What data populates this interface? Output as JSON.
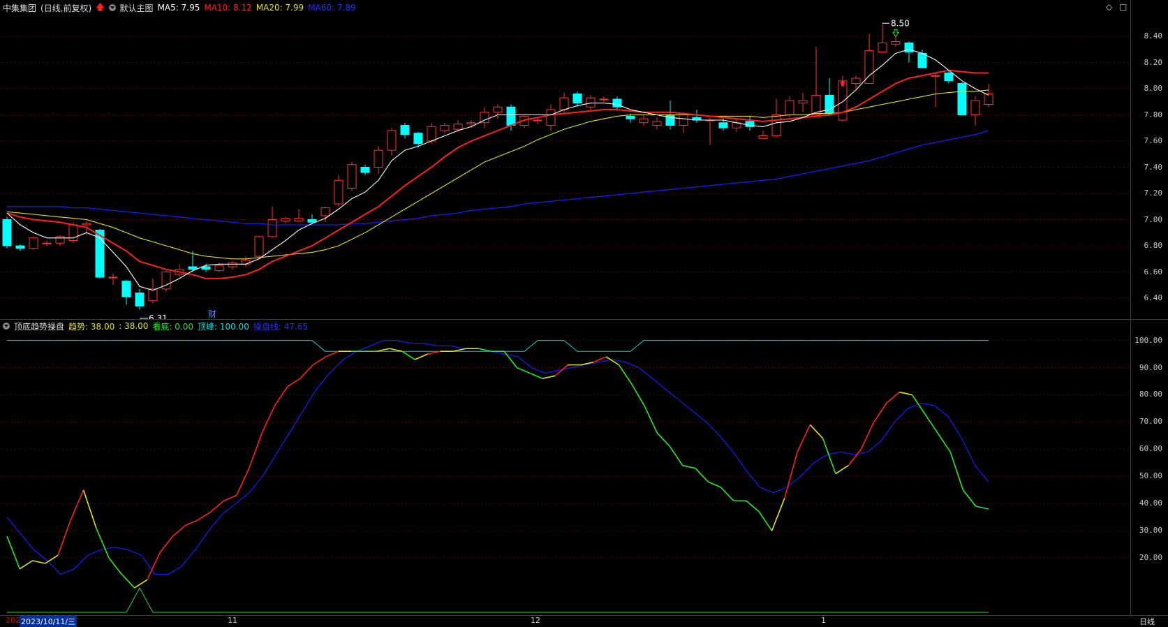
{
  "header": {
    "stock_name": "中集集团",
    "period": "(日线,前复权)",
    "chart_template": "默认主图",
    "ma5": "MA5: 7.95",
    "ma10": "MA10: 8.12",
    "ma20": "MA20: 7.99",
    "ma60": "MA60: 7.89"
  },
  "indicator_header": {
    "name": "顶底趋势操盘",
    "trend": "趋势: 38.00",
    "trend2": ": 38.00",
    "bottom": "看底: 0.00",
    "top": "顶峰: 100.00",
    "baseline": "操盘线: 47.65"
  },
  "annotations": {
    "high_label": "8.50",
    "low_label": "6.31",
    "finance_mark": "财"
  },
  "bottom_bar": {
    "date_cursor": "2023/10/11/三",
    "month_start": "202",
    "m11": "11",
    "m12": "12",
    "m1": "1",
    "period_button": "日线"
  },
  "right_buttons": {
    "diamond": "◇",
    "square": "□"
  },
  "price_axis": [
    "8.40",
    "8.20",
    "8.00",
    "7.80",
    "7.60",
    "7.40",
    "7.20",
    "7.00",
    "6.80",
    "6.60",
    "6.40"
  ],
  "ind_axis": [
    "100.00",
    "90.00",
    "80.00",
    "70.00",
    "60.00",
    "50.00",
    "40.00",
    "30.00",
    "20.00"
  ],
  "colors": {
    "up": "#ff3232",
    "down": "#00ffff",
    "ma5": "#ffffff",
    "ma10": "#ff2020",
    "ma20": "#e6e600",
    "ma60": "#1a1aff",
    "frame": "#c00000",
    "grid": "#5a0000"
  },
  "chart_data": {
    "type": "candlestick",
    "price_ylim": [
      6.24,
      8.56
    ],
    "candles": [
      [
        7.0,
        6.8,
        7.02,
        6.78
      ],
      [
        6.8,
        6.78,
        6.81,
        6.76
      ],
      [
        6.78,
        6.86,
        6.87,
        6.77
      ],
      [
        6.82,
        6.82,
        6.84,
        6.8
      ],
      [
        6.82,
        6.87,
        6.88,
        6.8
      ],
      [
        6.84,
        6.96,
        6.98,
        6.82
      ],
      [
        6.96,
        6.97,
        6.99,
        6.88
      ],
      [
        6.92,
        6.56,
        6.93,
        6.55
      ],
      [
        6.56,
        6.56,
        6.59,
        6.5
      ],
      [
        6.53,
        6.41,
        6.54,
        6.35
      ],
      [
        6.44,
        6.34,
        6.47,
        6.31
      ],
      [
        6.38,
        6.47,
        6.55,
        6.36
      ],
      [
        6.47,
        6.6,
        6.61,
        6.45
      ],
      [
        6.58,
        6.62,
        6.66,
        6.56
      ],
      [
        6.64,
        6.62,
        6.76,
        6.6
      ],
      [
        6.64,
        6.62,
        6.66,
        6.6
      ],
      [
        6.61,
        6.65,
        6.67,
        6.6
      ],
      [
        6.64,
        6.67,
        6.68,
        6.62
      ],
      [
        6.66,
        6.69,
        6.72,
        6.64
      ],
      [
        6.72,
        6.87,
        6.88,
        6.7
      ],
      [
        6.87,
        7.0,
        7.1,
        6.86
      ],
      [
        6.99,
        7.01,
        7.02,
        6.97
      ],
      [
        6.99,
        7.01,
        7.08,
        6.98
      ],
      [
        7.0,
        6.98,
        7.04,
        6.96
      ],
      [
        7.03,
        7.09,
        7.1,
        6.98
      ],
      [
        7.12,
        7.3,
        7.34,
        7.1
      ],
      [
        7.24,
        7.42,
        7.44,
        7.22
      ],
      [
        7.4,
        7.36,
        7.42,
        7.34
      ],
      [
        7.4,
        7.53,
        7.56,
        7.35
      ],
      [
        7.53,
        7.68,
        7.7,
        7.49
      ],
      [
        7.72,
        7.65,
        7.74,
        7.62
      ],
      [
        7.66,
        7.58,
        7.67,
        7.55
      ],
      [
        7.6,
        7.71,
        7.74,
        7.58
      ],
      [
        7.68,
        7.72,
        7.74,
        7.66
      ],
      [
        7.69,
        7.73,
        7.76,
        7.67
      ],
      [
        7.73,
        7.74,
        7.76,
        7.7
      ],
      [
        7.74,
        7.82,
        7.86,
        7.7
      ],
      [
        7.82,
        7.86,
        7.88,
        7.77
      ],
      [
        7.86,
        7.72,
        7.88,
        7.68
      ],
      [
        7.72,
        7.79,
        7.8,
        7.7
      ],
      [
        7.76,
        7.76,
        7.78,
        7.73
      ],
      [
        7.72,
        7.84,
        7.88,
        7.68
      ],
      [
        7.84,
        7.93,
        7.97,
        7.8
      ],
      [
        7.96,
        7.89,
        7.98,
        7.86
      ],
      [
        7.86,
        7.93,
        7.95,
        7.84
      ],
      [
        7.92,
        7.92,
        7.94,
        7.9
      ],
      [
        7.92,
        7.86,
        7.94,
        7.83
      ],
      [
        7.79,
        7.77,
        7.81,
        7.74
      ],
      [
        7.74,
        7.77,
        7.8,
        7.72
      ],
      [
        7.72,
        7.75,
        7.78,
        7.69
      ],
      [
        7.8,
        7.72,
        7.91,
        7.69
      ],
      [
        7.72,
        7.8,
        7.82,
        7.66
      ],
      [
        7.78,
        7.76,
        7.84,
        7.74
      ],
      [
        7.76,
        7.76,
        7.78,
        7.57
      ],
      [
        7.74,
        7.7,
        7.77,
        7.68
      ],
      [
        7.7,
        7.74,
        7.76,
        7.67
      ],
      [
        7.75,
        7.71,
        7.79,
        7.68
      ],
      [
        7.62,
        7.64,
        7.68,
        7.62
      ],
      [
        7.64,
        7.8,
        7.92,
        7.63
      ],
      [
        7.8,
        7.91,
        7.94,
        7.78
      ],
      [
        7.89,
        7.91,
        7.97,
        7.82
      ],
      [
        7.8,
        7.95,
        8.32,
        7.8
      ],
      [
        7.95,
        7.81,
        8.08,
        7.79
      ],
      [
        7.76,
        8.06,
        8.1,
        7.75
      ],
      [
        8.04,
        8.08,
        8.1,
        8.0
      ],
      [
        8.04,
        8.29,
        8.42,
        8.04
      ],
      [
        8.28,
        8.35,
        8.5,
        8.28
      ],
      [
        8.34,
        8.36,
        8.4,
        8.32
      ],
      [
        8.35,
        8.28,
        8.36,
        8.2
      ],
      [
        8.27,
        8.16,
        8.3,
        8.16
      ],
      [
        8.1,
        8.1,
        8.12,
        7.86
      ],
      [
        8.12,
        8.06,
        8.14,
        8.04
      ],
      [
        8.04,
        7.8,
        8.05,
        7.8
      ],
      [
        7.8,
        7.91,
        7.94,
        7.72
      ],
      [
        7.88,
        7.96,
        8.04,
        7.86
      ]
    ],
    "ma5": [
      7.05,
      6.96,
      6.9,
      6.86,
      6.86,
      6.86,
      6.9,
      6.86,
      6.75,
      6.64,
      6.49,
      6.46,
      6.5,
      6.55,
      6.61,
      6.65,
      6.66,
      6.66,
      6.66,
      6.7,
      6.77,
      6.84,
      6.92,
      6.97,
      7.01,
      7.08,
      7.16,
      7.21,
      7.3,
      7.45,
      7.53,
      7.56,
      7.6,
      7.64,
      7.68,
      7.71,
      7.76,
      7.8,
      7.8,
      7.8,
      7.8,
      7.8,
      7.84,
      7.87,
      7.89,
      7.89,
      7.88,
      7.84,
      7.82,
      7.8,
      7.78,
      7.77,
      7.76,
      7.76,
      7.76,
      7.74,
      7.72,
      7.71,
      7.74,
      7.75,
      7.78,
      7.82,
      7.84,
      7.9,
      7.99,
      8.1,
      8.18,
      8.27,
      8.3,
      8.27,
      8.22,
      8.14,
      8.06,
      8.0,
      7.95
    ],
    "ma10": [
      7.05,
      7.02,
      7.0,
      6.99,
      6.98,
      6.96,
      6.94,
      6.88,
      6.82,
      6.76,
      6.68,
      6.65,
      6.62,
      6.6,
      6.58,
      6.55,
      6.55,
      6.56,
      6.58,
      6.62,
      6.68,
      6.72,
      6.76,
      6.8,
      6.86,
      6.92,
      6.98,
      7.04,
      7.1,
      7.18,
      7.26,
      7.33,
      7.4,
      7.48,
      7.55,
      7.6,
      7.64,
      7.68,
      7.72,
      7.76,
      7.78,
      7.8,
      7.81,
      7.82,
      7.83,
      7.84,
      7.84,
      7.83,
      7.82,
      7.82,
      7.82,
      7.81,
      7.8,
      7.79,
      7.78,
      7.77,
      7.76,
      7.75,
      7.76,
      7.77,
      7.78,
      7.79,
      7.8,
      7.82,
      7.86,
      7.92,
      7.98,
      8.04,
      8.08,
      8.1,
      8.12,
      8.14,
      8.13,
      8.12,
      8.12
    ],
    "ma20": [
      7.06,
      7.05,
      7.04,
      7.03,
      7.02,
      7.01,
      7.0,
      6.97,
      6.94,
      6.9,
      6.86,
      6.83,
      6.8,
      6.77,
      6.74,
      6.72,
      6.71,
      6.7,
      6.7,
      6.71,
      6.72,
      6.73,
      6.74,
      6.75,
      6.77,
      6.8,
      6.85,
      6.9,
      6.96,
      7.02,
      7.08,
      7.14,
      7.2,
      7.26,
      7.32,
      7.38,
      7.44,
      7.48,
      7.52,
      7.56,
      7.61,
      7.65,
      7.69,
      7.72,
      7.75,
      7.77,
      7.79,
      7.8,
      7.8,
      7.8,
      7.8,
      7.8,
      7.8,
      7.79,
      7.79,
      7.79,
      7.79,
      7.78,
      7.79,
      7.8,
      7.8,
      7.81,
      7.81,
      7.82,
      7.84,
      7.86,
      7.88,
      7.9,
      7.92,
      7.94,
      7.96,
      7.97,
      7.98,
      7.98,
      7.99
    ],
    "ma60": [
      7.1,
      7.1,
      7.1,
      7.1,
      7.1,
      7.09,
      7.09,
      7.08,
      7.07,
      7.06,
      7.05,
      7.04,
      7.03,
      7.02,
      7.01,
      7.0,
      6.99,
      6.98,
      6.97,
      6.97,
      6.96,
      6.96,
      6.96,
      6.96,
      6.96,
      6.96,
      6.97,
      6.97,
      6.98,
      6.99,
      7.0,
      7.01,
      7.03,
      7.04,
      7.05,
      7.07,
      7.08,
      7.09,
      7.1,
      7.12,
      7.13,
      7.14,
      7.15,
      7.16,
      7.17,
      7.18,
      7.19,
      7.2,
      7.21,
      7.22,
      7.23,
      7.24,
      7.25,
      7.26,
      7.27,
      7.28,
      7.29,
      7.3,
      7.31,
      7.33,
      7.35,
      7.37,
      7.39,
      7.41,
      7.43,
      7.45,
      7.48,
      7.51,
      7.54,
      7.57,
      7.59,
      7.61,
      7.63,
      7.65,
      7.68
    ],
    "ind_ylim": [
      0,
      104
    ],
    "trend": [
      28,
      16,
      19,
      18,
      21,
      34,
      45,
      31,
      20,
      14,
      9,
      12,
      22,
      28,
      32,
      34,
      37,
      41,
      43,
      53,
      66,
      76,
      83,
      86,
      91,
      94,
      96,
      96,
      96,
      96,
      97,
      96,
      93,
      95,
      96,
      96,
      97,
      97,
      96,
      96,
      90,
      88,
      86,
      87,
      91,
      91,
      92,
      94,
      91,
      84,
      76,
      66,
      61,
      54,
      53,
      48,
      46,
      41,
      41,
      37,
      30,
      42,
      59,
      69,
      64,
      51,
      54,
      60,
      70,
      77,
      81,
      80,
      73,
      66,
      59,
      45,
      39,
      38
    ],
    "baseline": [
      35,
      29,
      23,
      19,
      14,
      16,
      21,
      23,
      24,
      23,
      21,
      14,
      14,
      17,
      23,
      30,
      36,
      40,
      44,
      50,
      58,
      66,
      74,
      82,
      88,
      93,
      96,
      98,
      100,
      100,
      99,
      99,
      98,
      98,
      97,
      97,
      96,
      95,
      94,
      90,
      88,
      89,
      90,
      91,
      92,
      93,
      92,
      90,
      86,
      82,
      78,
      74,
      70,
      65,
      59,
      52,
      46,
      44,
      46,
      50,
      55,
      58,
      59,
      58,
      59,
      63,
      70,
      75,
      77,
      76,
      72,
      64,
      54,
      48
    ]
  }
}
